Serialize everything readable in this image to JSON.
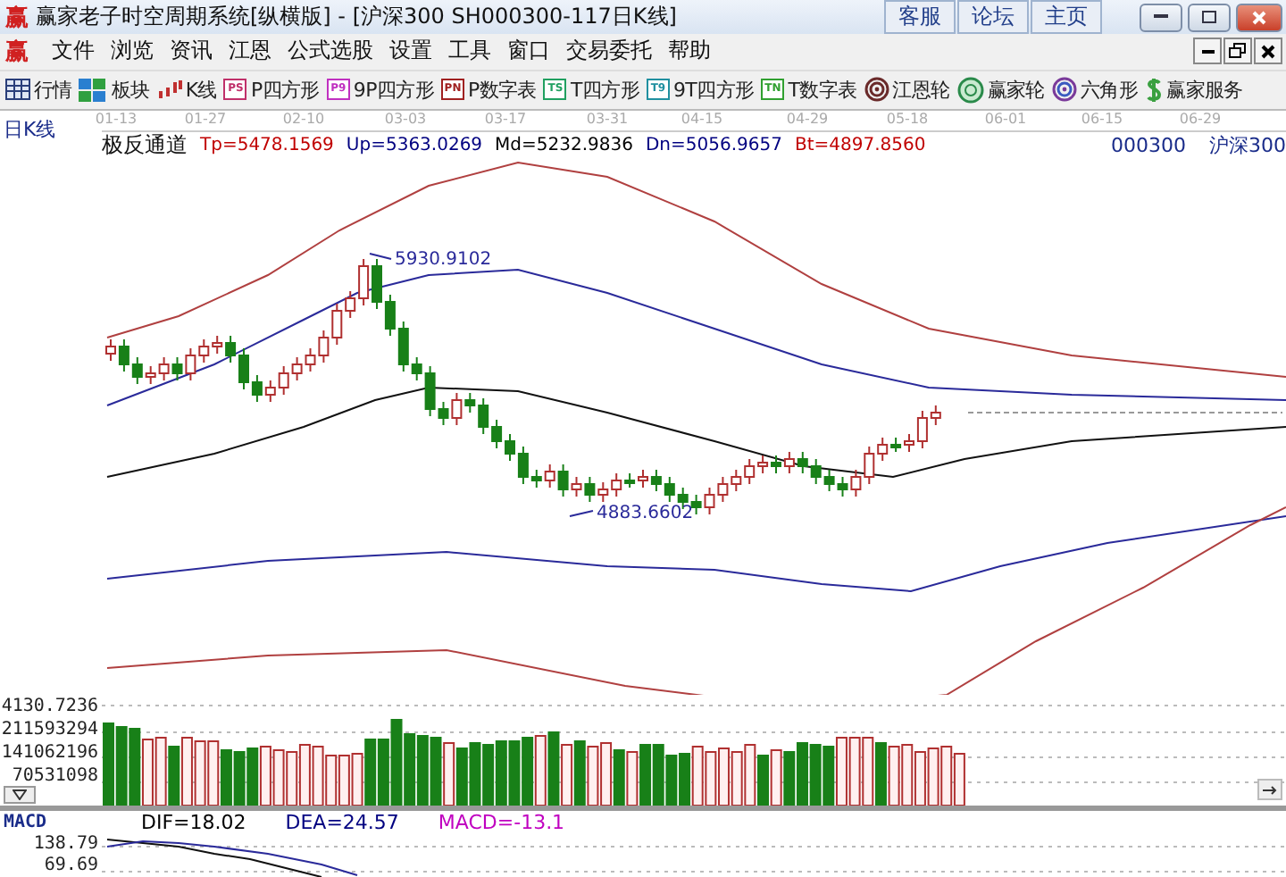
{
  "window": {
    "logo": "赢",
    "title": "赢家老子时空周期系统[纵横版] - [沪深300  SH000300-117日K线]"
  },
  "top_links": [
    "客服",
    "论坛",
    "主页"
  ],
  "menu": {
    "logo": "赢",
    "items": [
      "文件",
      "浏览",
      "资讯",
      "江恩",
      "公式选股",
      "设置",
      "工具",
      "窗口",
      "交易委托",
      "帮助"
    ]
  },
  "toolbar": [
    {
      "kind": "table",
      "label": "行情"
    },
    {
      "kind": "blocks",
      "label": "板块"
    },
    {
      "kind": "kline",
      "label": "K线"
    },
    {
      "kind": "badge",
      "badge": "PS",
      "color": "#c0306a",
      "label": "P四方形"
    },
    {
      "kind": "badge",
      "badge": "P9",
      "color": "#c030c0",
      "label": "9P四方形"
    },
    {
      "kind": "badge",
      "badge": "PN",
      "color": "#a02020",
      "label": "P数字表"
    },
    {
      "kind": "badge",
      "badge": "TS",
      "color": "#20a060",
      "label": "T四方形"
    },
    {
      "kind": "badge",
      "badge": "T9",
      "color": "#2090a0",
      "label": "9T四方形"
    },
    {
      "kind": "badge",
      "badge": "TN",
      "color": "#30a030",
      "label": "T数字表"
    },
    {
      "kind": "wheel",
      "label": "江恩轮"
    },
    {
      "kind": "coin",
      "label": "赢家轮"
    },
    {
      "kind": "target",
      "label": "六角形"
    },
    {
      "kind": "dollar",
      "label": "赢家服务"
    }
  ],
  "chart": {
    "period": "日K线",
    "dates": [
      "01-13",
      "01-27",
      "02-10",
      "03-03",
      "03-17",
      "03-31",
      "04-15",
      "04-29",
      "05-18",
      "06-01",
      "06-15",
      "06-29"
    ],
    "indicator": "极反通道",
    "params": [
      {
        "text": "Tp=5478.1569",
        "color": "#c00000"
      },
      {
        "text": "Up=5363.0269",
        "color": "#000080"
      },
      {
        "text": "Md=5232.9836",
        "color": "#000000"
      },
      {
        "text": "Dn=5056.9657",
        "color": "#000080"
      },
      {
        "text": "Bt=4897.8560",
        "color": "#c00000"
      }
    ],
    "code": "000300",
    "name": "沪深300",
    "high_label": "5930.9102",
    "low_label": "4883.6602"
  },
  "volume": {
    "top_label": "4130.7236",
    "ticks": [
      "211593294",
      "141062196",
      "70531098"
    ]
  },
  "macd": {
    "label": "MACD",
    "values": [
      {
        "text": "DIF=18.02",
        "color": "#000000"
      },
      {
        "text": "DEA=24.57",
        "color": "#000080"
      },
      {
        "text": "MACD=-13.1",
        "color": "#c000c0"
      }
    ],
    "ticks": [
      "138.79",
      "69.69"
    ]
  }
}
